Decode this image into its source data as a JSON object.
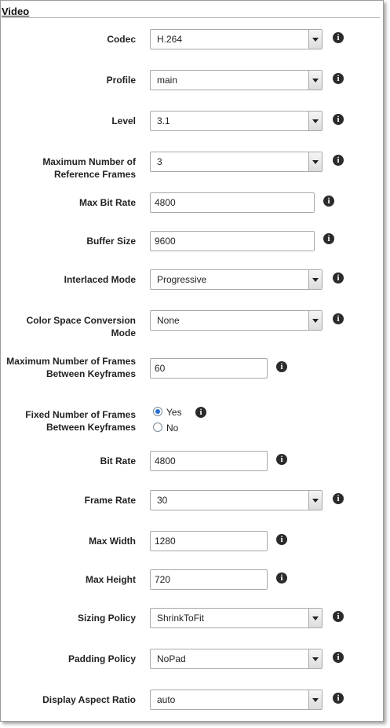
{
  "section": {
    "title": "Video"
  },
  "info_glyph": "i",
  "fields": {
    "codec": {
      "label": "Codec",
      "value": "H.264"
    },
    "profile": {
      "label": "Profile",
      "value": "main"
    },
    "level": {
      "label": "Level",
      "value": "3.1"
    },
    "max_ref_frames": {
      "label": "Maximum Number of Reference Frames",
      "value": "3"
    },
    "max_bit_rate": {
      "label": "Max Bit Rate",
      "value": "4800"
    },
    "buffer_size": {
      "label": "Buffer Size",
      "value": "9600"
    },
    "interlaced_mode": {
      "label": "Interlaced Mode",
      "value": "Progressive"
    },
    "color_space": {
      "label": "Color Space Conversion Mode",
      "value": "None"
    },
    "max_frames_keyframes": {
      "label": "Maximum Number of Frames Between Keyframes",
      "value": "60"
    },
    "fixed_frames_keyframes": {
      "label": "Fixed Number of Frames Between Keyframes",
      "option_yes": "Yes",
      "option_no": "No",
      "selected": "Yes"
    },
    "bit_rate": {
      "label": "Bit Rate",
      "value": "4800"
    },
    "frame_rate": {
      "label": "Frame Rate",
      "value": "30"
    },
    "max_width": {
      "label": "Max Width",
      "value": "1280"
    },
    "max_height": {
      "label": "Max Height",
      "value": "720"
    },
    "sizing_policy": {
      "label": "Sizing Policy",
      "value": "ShrinkToFit"
    },
    "padding_policy": {
      "label": "Padding Policy",
      "value": "NoPad"
    },
    "display_aspect_ratio": {
      "label": "Display Aspect Ratio",
      "value": "auto"
    }
  }
}
